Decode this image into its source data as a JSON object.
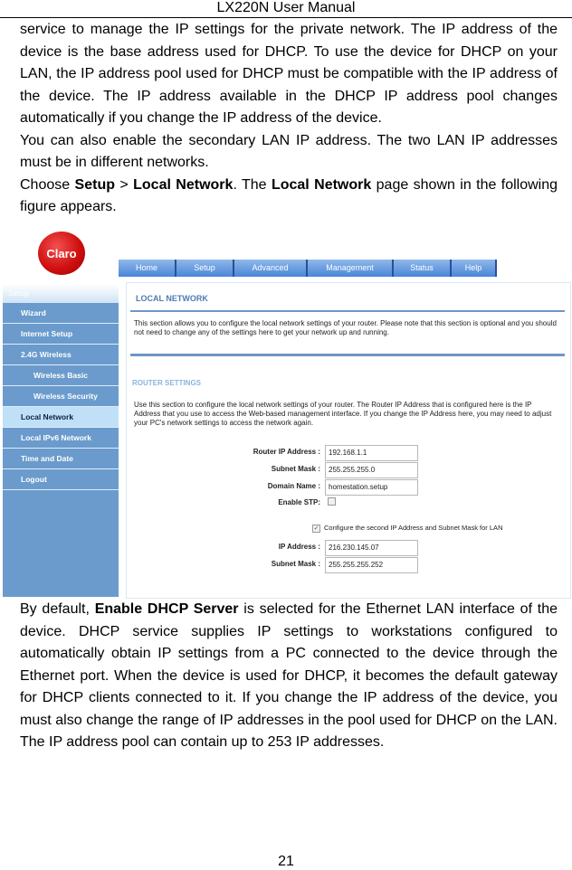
{
  "header": {
    "title": "LX220N User Manual"
  },
  "intro": {
    "p1": "service to manage the IP settings for the private network. The IP address of the device is the base address used for DHCP. To use the device for DHCP on your LAN, the IP address pool used for DHCP must be compatible with the IP address of the device. The IP address available in the DHCP IP address pool changes automatically if you change the IP address of the device.",
    "p2": "You can also enable the secondary LAN IP address. The two LAN IP addresses must be in different networks.",
    "p3_choose": "Choose ",
    "p3_setup": "Setup",
    "p3_sep": " > ",
    "p3_local": "Local Network",
    "p3_the": ". The ",
    "p3_local2": "Local Network",
    "p3_rest": " page shown in the following figure appears."
  },
  "router_ui": {
    "logo": "Claro",
    "nav_tabs": [
      "Home",
      "Setup",
      "Advanced",
      "Management",
      "Status",
      "Help"
    ],
    "sidebar": {
      "heading": "Setup",
      "items": [
        {
          "label": "Wizard"
        },
        {
          "label": "Internet Setup"
        },
        {
          "label": "2.4G Wireless"
        },
        {
          "label": "Wireless Basic"
        },
        {
          "label": "Wireless Security"
        },
        {
          "label": "Local Network"
        },
        {
          "label": "Local IPv6 Network"
        },
        {
          "label": "Time and Date"
        },
        {
          "label": "Logout"
        }
      ]
    },
    "page_title": "LOCAL NETWORK",
    "page_desc": "This section allows you to configure the local network settings of your router. Please note that this section is optional and you should not need to change any of the settings here to get your network up and running.",
    "section_title": "ROUTER SETTINGS",
    "section_desc": "Use this section to configure the local network settings of your router. The Router IP Address that is configured here is the IP Address that you use to access the Web-based management interface. If you change the IP Address here, you may need to adjust your PC's network settings to access the network again.",
    "fields": {
      "router_ip_label": "Router IP Address :",
      "router_ip_value": "192.168.1.1",
      "subnet_label": "Subnet Mask :",
      "subnet_value": "255.255.255.0",
      "domain_label": "Domain Name :",
      "domain_value": "homestation.setup",
      "stp_label": "Enable STP:",
      "second_ip_check_label": "Configure the second IP Address and Subnet Mask for LAN",
      "ip2_label": "IP Address :",
      "ip2_value": "216.230.145.07",
      "subnet2_label": "Subnet Mask :",
      "subnet2_value": "255.255.255.252"
    }
  },
  "body": {
    "p_pre": "By default, ",
    "p_bold": "Enable DHCP Server",
    "p_post": " is selected for the Ethernet LAN interface of the device. DHCP service supplies IP settings to workstations configured to automatically obtain IP settings from a PC connected to the device through the Ethernet port. When the device is used for DHCP, it becomes the default gateway for DHCP clients connected to it. If you change the IP address of the device, you must also change the range of IP addresses in the pool used for DHCP on the LAN. The IP address pool can contain up to 253 IP addresses."
  },
  "footer": {
    "page_number": "21"
  }
}
